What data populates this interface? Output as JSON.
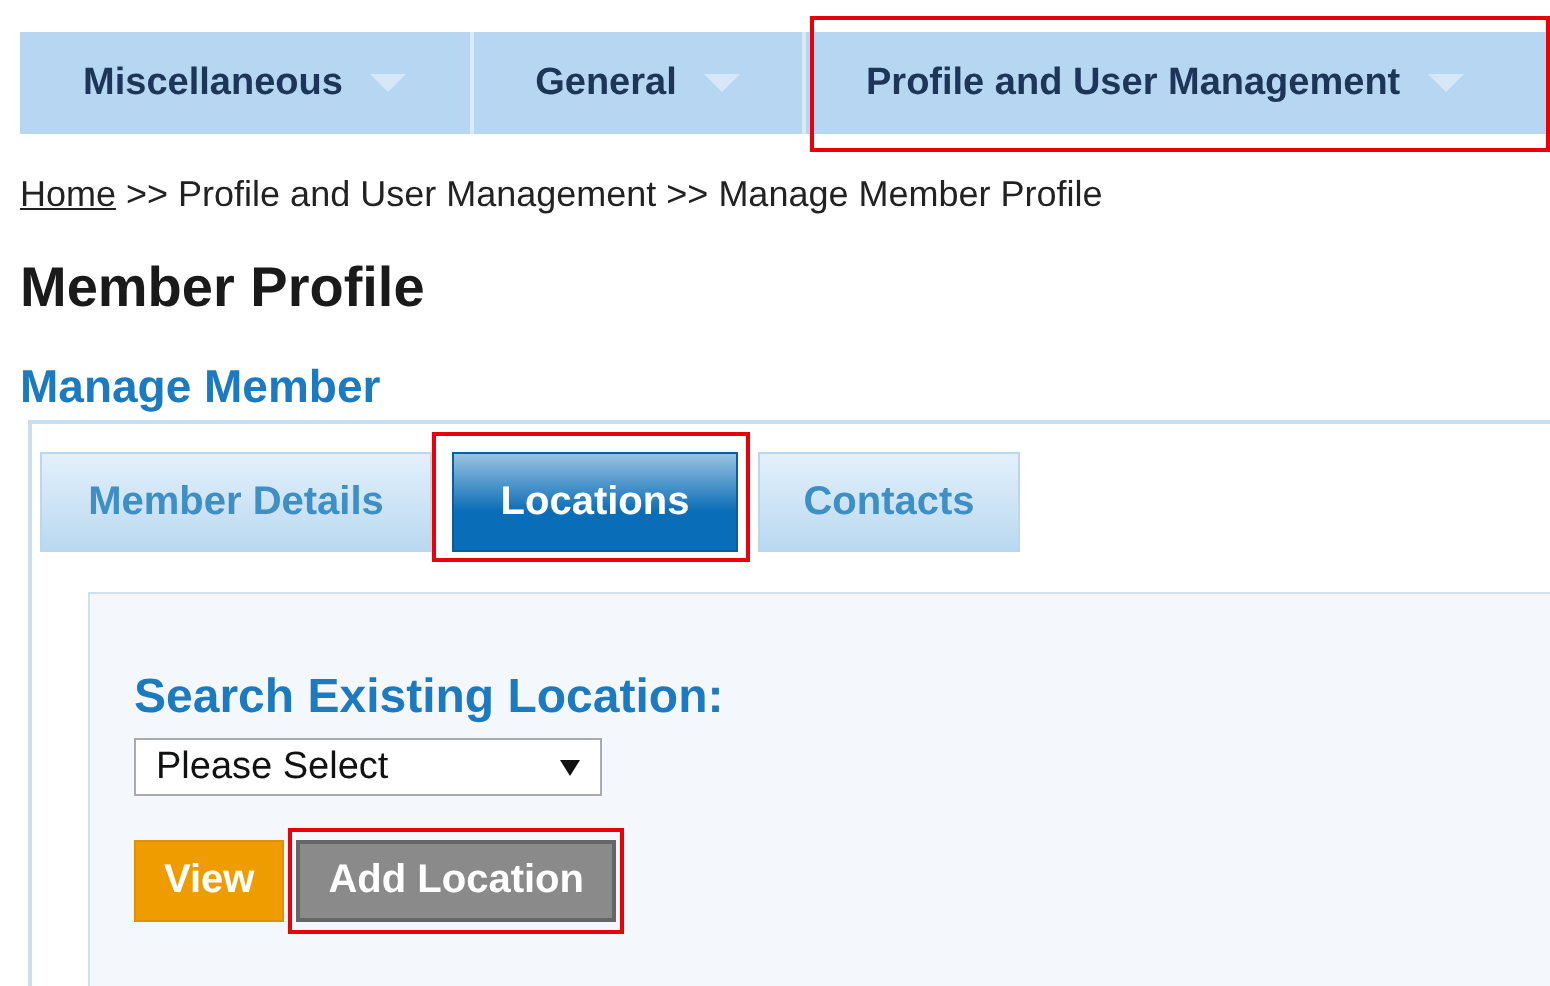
{
  "menu": [
    {
      "label": "Miscellaneous",
      "highlighted": false
    },
    {
      "label": "General",
      "highlighted": false
    },
    {
      "label": "Profile and User Management",
      "highlighted": true
    }
  ],
  "breadcrumb": [
    {
      "label": "Home",
      "kind": "link"
    },
    {
      "label": ">> Profile and User Management >> Manage Member Profile",
      "kind": "text"
    }
  ],
  "page_title": "Member Profile",
  "section_title": "Manage Member",
  "tabs": [
    {
      "label": "Member Details",
      "selected": false,
      "highlighted": false
    },
    {
      "label": "Locations",
      "selected": true,
      "highlighted": true
    },
    {
      "label": "Contacts",
      "selected": false,
      "highlighted": false
    }
  ],
  "search": {
    "label": "Search Existing Location:",
    "value": "Please Select"
  },
  "buttons": [
    {
      "label": "View",
      "kind": "primary",
      "highlighted": false
    },
    {
      "label": "Add Location",
      "kind": "secondary",
      "highlighted": true
    }
  ]
}
